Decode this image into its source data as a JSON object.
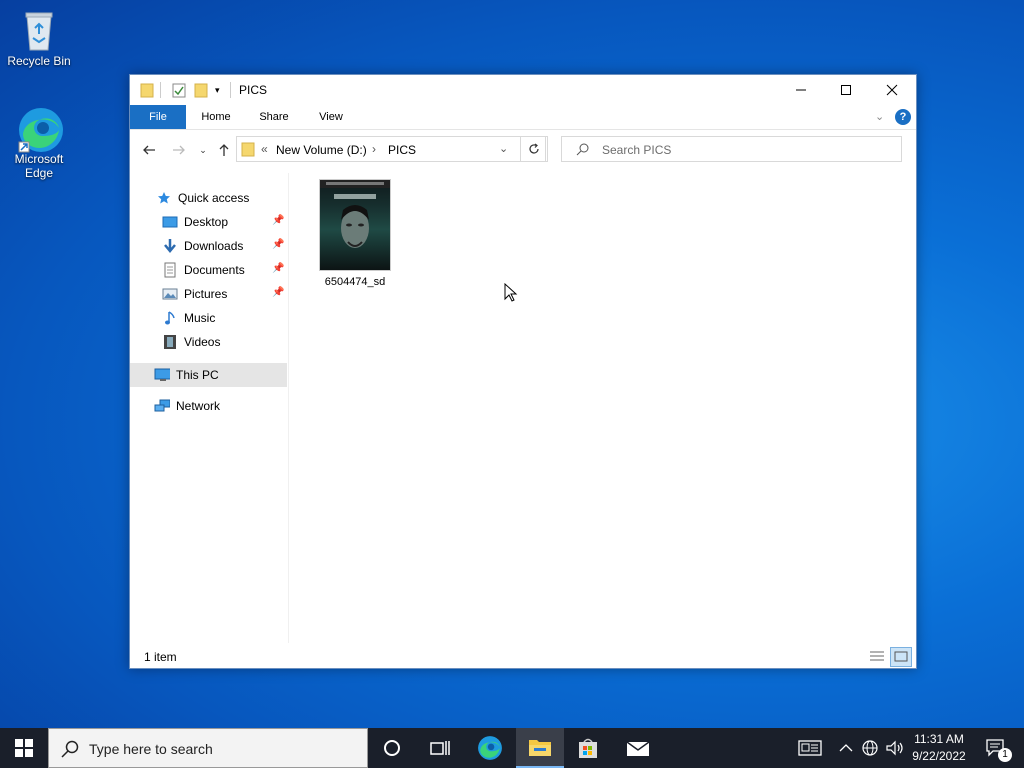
{
  "desktop": {
    "icons": [
      {
        "label": "Recycle Bin",
        "icon": "recycle-bin-icon"
      },
      {
        "label": "Microsoft\nEdge",
        "line1": "Microsoft",
        "line2": "Edge",
        "icon": "edge-icon"
      }
    ]
  },
  "window": {
    "title": "PICS",
    "ribbon_tabs": [
      "File",
      "Home",
      "Share",
      "View"
    ],
    "address": {
      "chevrons": "«",
      "segments": [
        "New Volume (D:)",
        "PICS"
      ]
    },
    "search": {
      "placeholder": "Search PICS"
    },
    "sidebar": {
      "items": [
        {
          "label": "Quick access",
          "icon": "star-icon",
          "pinned": false
        },
        {
          "label": "Desktop",
          "icon": "desktop-icon",
          "pinned": true
        },
        {
          "label": "Downloads",
          "icon": "download-arrow-icon",
          "pinned": true
        },
        {
          "label": "Documents",
          "icon": "document-icon",
          "pinned": true
        },
        {
          "label": "Pictures",
          "icon": "pictures-icon",
          "pinned": true
        },
        {
          "label": "Music",
          "icon": "music-note-icon",
          "pinned": false
        },
        {
          "label": "Videos",
          "icon": "film-icon",
          "pinned": false
        },
        {
          "label": "This PC",
          "icon": "computer-icon",
          "pinned": false,
          "selected": true
        },
        {
          "label": "Network",
          "icon": "network-icon",
          "pinned": false
        }
      ]
    },
    "files": [
      {
        "name": "6504474_sd",
        "type": "image"
      }
    ],
    "status": {
      "item_count": "1 item"
    }
  },
  "taskbar": {
    "search_placeholder": "Type here to search",
    "time": "11:31 AM",
    "date": "9/22/2022",
    "notification_count": "1"
  },
  "colors": {
    "accent": "#1a6fc4",
    "selected_bg": "#e5e5e5",
    "taskbar": "#1a1f2a",
    "folder": "#f5d76e"
  }
}
